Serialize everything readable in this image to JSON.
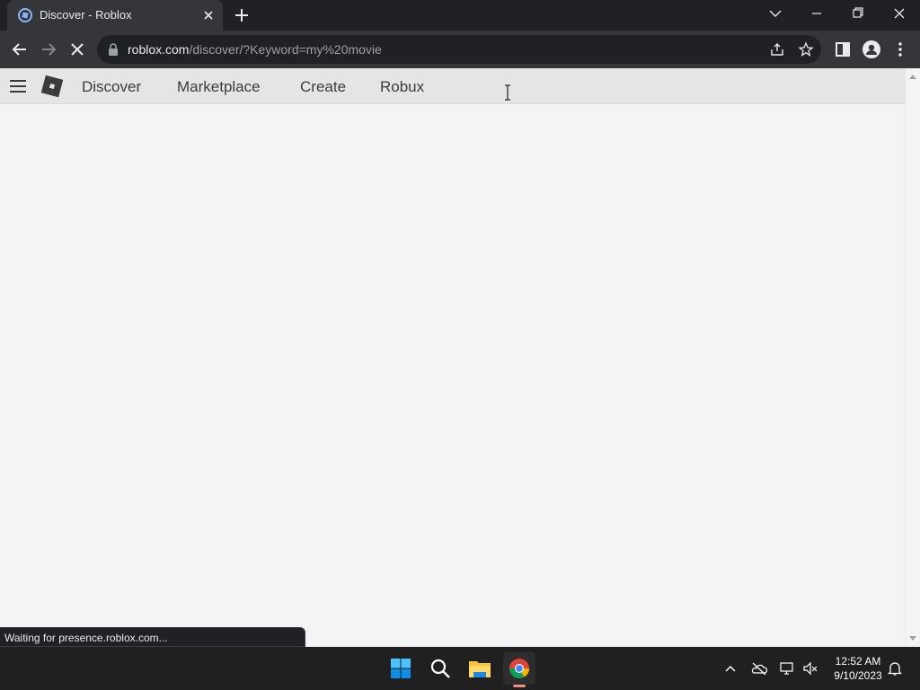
{
  "browser": {
    "tab": {
      "title": "Discover - Roblox"
    },
    "omnibox": {
      "url_host": "roblox.com",
      "url_rest": "/discover/?Keyword=my%20movie"
    },
    "status_text": "Waiting for presence.roblox.com..."
  },
  "site": {
    "nav": {
      "discover": "Discover",
      "marketplace": "Marketplace",
      "create": "Create",
      "robux": "Robux"
    }
  },
  "taskbar": {
    "clock_time": "12:52 AM",
    "clock_date": "9/10/2023"
  },
  "icons": {
    "tab_favicon": "roblox-favicon-icon",
    "loading": "stop-loading-icon",
    "tray": [
      "chevron-up-icon",
      "onedrive-offline-icon",
      "network-icon",
      "volume-muted-icon",
      "notification-bell-icon"
    ]
  },
  "colors": {
    "page_background": "#f2f4f5",
    "header_background": "#e3e5e7",
    "browser_dark": "#202124",
    "taskbar": "#202020"
  }
}
